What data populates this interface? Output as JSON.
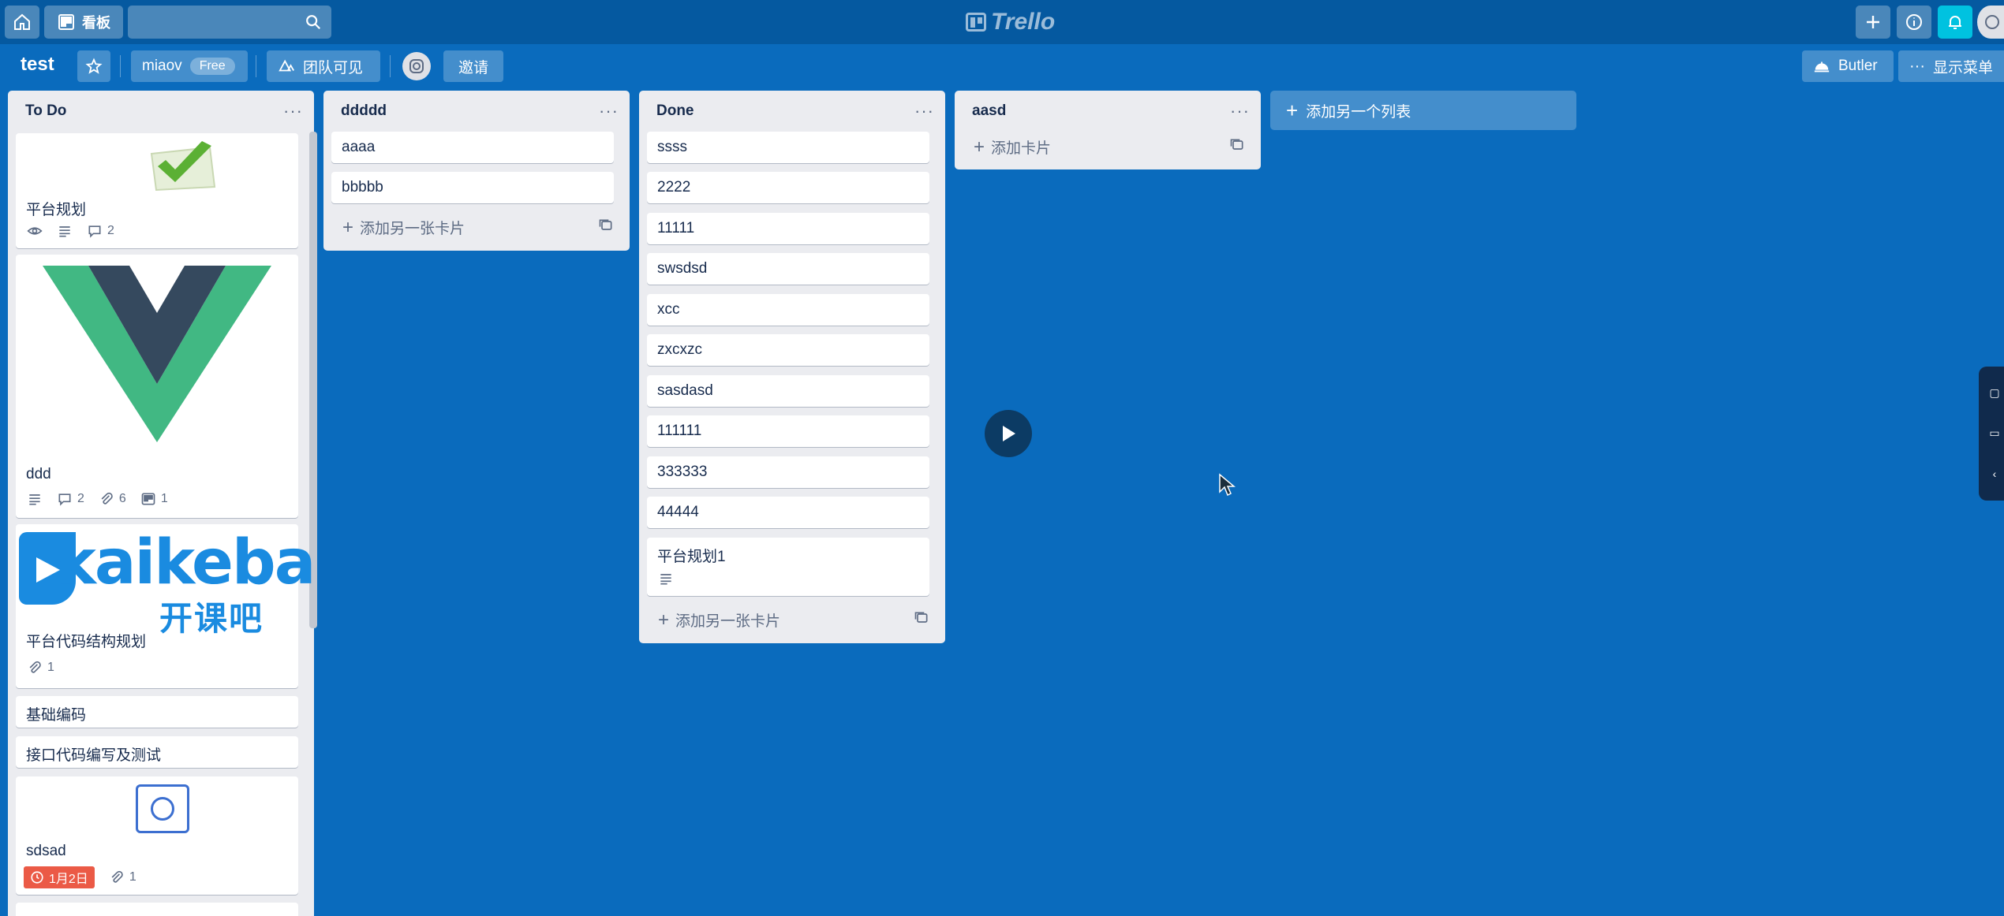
{
  "topbar": {
    "home_icon": "home-icon",
    "boards_label": "看板",
    "search_placeholder": "",
    "logo_text": "Trello",
    "right_icons": [
      "plus-icon",
      "info-icon",
      "bell-icon",
      "avatar"
    ]
  },
  "board_header": {
    "title": "test",
    "team_name": "miaov",
    "team_badge": "Free",
    "visibility": "团队可见",
    "invite": "邀请",
    "butler": "Butler",
    "show_menu": "显示菜单"
  },
  "lists": [
    {
      "title": "To Do",
      "cards": [
        {
          "title": "平台规划",
          "cover": "green-check-icon",
          "badges": {
            "comments": "2"
          }
        },
        {
          "title": "ddd",
          "cover": "vue-logo",
          "badges": {
            "comments": "2",
            "attachments": "6",
            "checklist": "1"
          }
        },
        {
          "title": "平台代码结构规划",
          "cover": "kaikeba-logo",
          "cover_text": "kaikeba",
          "cover_sub": "开课吧",
          "badges": {
            "attachments": "1"
          }
        },
        {
          "title": "基础编码"
        },
        {
          "title": "接口代码编写及测试"
        },
        {
          "title": "sdsad",
          "cover": "avatar-icon",
          "badges": {
            "due": "1月2日",
            "attachments": "1"
          }
        }
      ]
    },
    {
      "title": "ddddd",
      "cards": [
        {
          "title": "aaaa"
        },
        {
          "title": "bbbbb"
        }
      ],
      "add_card": "添加另一张卡片"
    },
    {
      "title": "Done",
      "cards": [
        {
          "title": "ssss"
        },
        {
          "title": "2222"
        },
        {
          "title": "11111"
        },
        {
          "title": "swsdsd"
        },
        {
          "title": "xcc"
        },
        {
          "title": "zxcxzc"
        },
        {
          "title": "sasdasd"
        },
        {
          "title": "111111"
        },
        {
          "title": "333333"
        },
        {
          "title": "44444"
        },
        {
          "title": "平台规划1"
        }
      ],
      "add_card": "添加另一张卡片"
    },
    {
      "title": "aasd",
      "cards": [],
      "add_card": "添加卡片"
    }
  ],
  "add_list": "添加另一个列表",
  "colors": {
    "board_bg": "#0a6bbd",
    "topbar_bg": "#0559a0",
    "list_bg": "#ebecf0",
    "due_badge": "#eb5a46",
    "vue_green": "#41b883",
    "vue_dark": "#35495e",
    "kaikeba_blue": "#1a8be0"
  }
}
